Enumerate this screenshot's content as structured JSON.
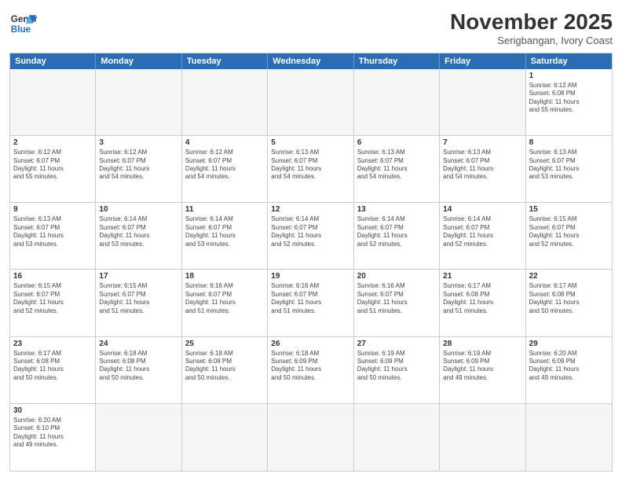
{
  "header": {
    "logo_line1": "General",
    "logo_line2": "Blue",
    "month_title": "November 2025",
    "subtitle": "Serigbangan, Ivory Coast"
  },
  "day_headers": [
    "Sunday",
    "Monday",
    "Tuesday",
    "Wednesday",
    "Thursday",
    "Friday",
    "Saturday"
  ],
  "weeks": [
    [
      {
        "day": "",
        "info": ""
      },
      {
        "day": "",
        "info": ""
      },
      {
        "day": "",
        "info": ""
      },
      {
        "day": "",
        "info": ""
      },
      {
        "day": "",
        "info": ""
      },
      {
        "day": "",
        "info": ""
      },
      {
        "day": "1",
        "info": "Sunrise: 6:12 AM\nSunset: 6:08 PM\nDaylight: 11 hours\nand 55 minutes."
      }
    ],
    [
      {
        "day": "2",
        "info": "Sunrise: 6:12 AM\nSunset: 6:07 PM\nDaylight: 11 hours\nand 55 minutes."
      },
      {
        "day": "3",
        "info": "Sunrise: 6:12 AM\nSunset: 6:07 PM\nDaylight: 11 hours\nand 54 minutes."
      },
      {
        "day": "4",
        "info": "Sunrise: 6:12 AM\nSunset: 6:07 PM\nDaylight: 11 hours\nand 54 minutes."
      },
      {
        "day": "5",
        "info": "Sunrise: 6:13 AM\nSunset: 6:07 PM\nDaylight: 11 hours\nand 54 minutes."
      },
      {
        "day": "6",
        "info": "Sunrise: 6:13 AM\nSunset: 6:07 PM\nDaylight: 11 hours\nand 54 minutes."
      },
      {
        "day": "7",
        "info": "Sunrise: 6:13 AM\nSunset: 6:07 PM\nDaylight: 11 hours\nand 54 minutes."
      },
      {
        "day": "8",
        "info": "Sunrise: 6:13 AM\nSunset: 6:07 PM\nDaylight: 11 hours\nand 53 minutes."
      }
    ],
    [
      {
        "day": "9",
        "info": "Sunrise: 6:13 AM\nSunset: 6:07 PM\nDaylight: 11 hours\nand 53 minutes."
      },
      {
        "day": "10",
        "info": "Sunrise: 6:14 AM\nSunset: 6:07 PM\nDaylight: 11 hours\nand 53 minutes."
      },
      {
        "day": "11",
        "info": "Sunrise: 6:14 AM\nSunset: 6:07 PM\nDaylight: 11 hours\nand 53 minutes."
      },
      {
        "day": "12",
        "info": "Sunrise: 6:14 AM\nSunset: 6:07 PM\nDaylight: 11 hours\nand 52 minutes."
      },
      {
        "day": "13",
        "info": "Sunrise: 6:14 AM\nSunset: 6:07 PM\nDaylight: 11 hours\nand 52 minutes."
      },
      {
        "day": "14",
        "info": "Sunrise: 6:14 AM\nSunset: 6:07 PM\nDaylight: 11 hours\nand 52 minutes."
      },
      {
        "day": "15",
        "info": "Sunrise: 6:15 AM\nSunset: 6:07 PM\nDaylight: 11 hours\nand 52 minutes."
      }
    ],
    [
      {
        "day": "16",
        "info": "Sunrise: 6:15 AM\nSunset: 6:07 PM\nDaylight: 11 hours\nand 52 minutes."
      },
      {
        "day": "17",
        "info": "Sunrise: 6:15 AM\nSunset: 6:07 PM\nDaylight: 11 hours\nand 51 minutes."
      },
      {
        "day": "18",
        "info": "Sunrise: 6:16 AM\nSunset: 6:07 PM\nDaylight: 11 hours\nand 51 minutes."
      },
      {
        "day": "19",
        "info": "Sunrise: 6:16 AM\nSunset: 6:07 PM\nDaylight: 11 hours\nand 51 minutes."
      },
      {
        "day": "20",
        "info": "Sunrise: 6:16 AM\nSunset: 6:07 PM\nDaylight: 11 hours\nand 51 minutes."
      },
      {
        "day": "21",
        "info": "Sunrise: 6:17 AM\nSunset: 6:08 PM\nDaylight: 11 hours\nand 51 minutes."
      },
      {
        "day": "22",
        "info": "Sunrise: 6:17 AM\nSunset: 6:08 PM\nDaylight: 11 hours\nand 50 minutes."
      }
    ],
    [
      {
        "day": "23",
        "info": "Sunrise: 6:17 AM\nSunset: 6:08 PM\nDaylight: 11 hours\nand 50 minutes."
      },
      {
        "day": "24",
        "info": "Sunrise: 6:18 AM\nSunset: 6:08 PM\nDaylight: 11 hours\nand 50 minutes."
      },
      {
        "day": "25",
        "info": "Sunrise: 6:18 AM\nSunset: 6:08 PM\nDaylight: 11 hours\nand 50 minutes."
      },
      {
        "day": "26",
        "info": "Sunrise: 6:18 AM\nSunset: 6:09 PM\nDaylight: 11 hours\nand 50 minutes."
      },
      {
        "day": "27",
        "info": "Sunrise: 6:19 AM\nSunset: 6:09 PM\nDaylight: 11 hours\nand 50 minutes."
      },
      {
        "day": "28",
        "info": "Sunrise: 6:19 AM\nSunset: 6:09 PM\nDaylight: 11 hours\nand 49 minutes."
      },
      {
        "day": "29",
        "info": "Sunrise: 6:20 AM\nSunset: 6:09 PM\nDaylight: 11 hours\nand 49 minutes."
      }
    ],
    [
      {
        "day": "30",
        "info": "Sunrise: 6:20 AM\nSunset: 6:10 PM\nDaylight: 11 hours\nand 49 minutes."
      },
      {
        "day": "",
        "info": ""
      },
      {
        "day": "",
        "info": ""
      },
      {
        "day": "",
        "info": ""
      },
      {
        "day": "",
        "info": ""
      },
      {
        "day": "",
        "info": ""
      },
      {
        "day": "",
        "info": ""
      }
    ]
  ]
}
